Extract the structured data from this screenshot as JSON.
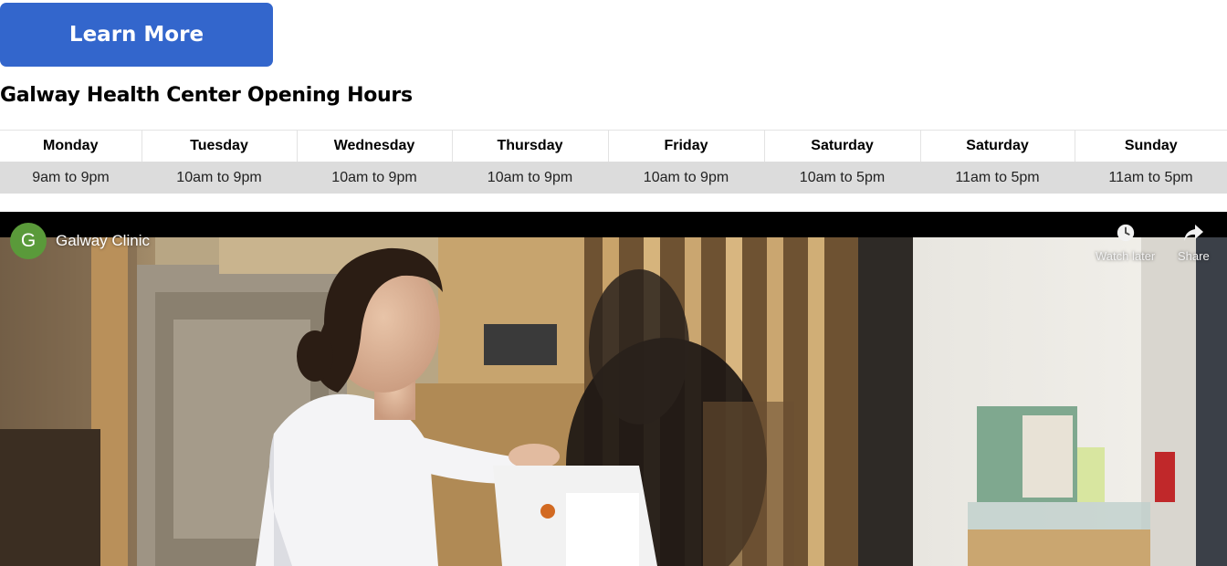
{
  "cta": {
    "label": "Learn More"
  },
  "hours": {
    "title": "Galway Health Center Opening Hours",
    "days": [
      "Monday",
      "Tuesday",
      "Wednesday",
      "Thursday",
      "Friday",
      "Saturday",
      "Saturday",
      "Sunday"
    ],
    "times": [
      "9am to 9pm",
      "10am to 9pm",
      "10am to 9pm",
      "10am to 9pm",
      "10am to 9pm",
      "10am to 5pm",
      "11am to 5pm",
      "11am to 5pm"
    ]
  },
  "video": {
    "channel_initial": "G",
    "channel_name": "Galway Clinic",
    "watch_later_label": "Watch later",
    "share_label": "Share",
    "watch_later_icon": "clock-icon",
    "share_icon": "share-arrow-icon"
  },
  "colors": {
    "button_bg": "#3366cc",
    "button_text": "#ffffff",
    "hours_row_bg": "#dcdcdc",
    "avatar_bg": "#5a9a3a"
  }
}
